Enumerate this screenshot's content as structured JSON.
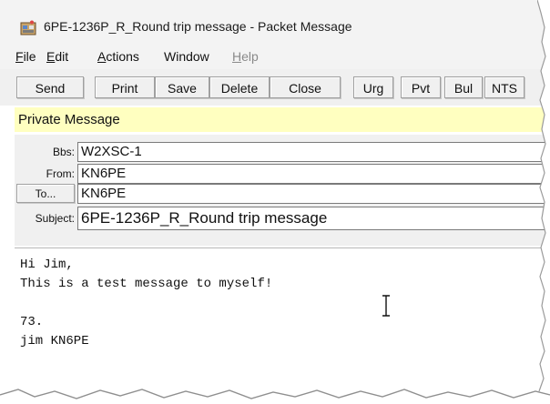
{
  "window": {
    "title": "6PE-1236P_R_Round trip message - Packet Message"
  },
  "menu": [
    {
      "label": "File",
      "underline": "F",
      "rest": "ile",
      "disabled": false
    },
    {
      "label": "Edit",
      "underline": "E",
      "rest": "dit",
      "disabled": false
    },
    {
      "label": "Actions",
      "underline": "A",
      "rest": "ctions",
      "disabled": false
    },
    {
      "label": "Window",
      "underline": "",
      "rest": "Window",
      "disabled": false
    },
    {
      "label": "Help",
      "underline": "H",
      "rest": "elp",
      "disabled": true
    }
  ],
  "toolbar": {
    "send": "Send",
    "print": "Print",
    "save": "Save",
    "delete": "Delete",
    "close": "Close",
    "urg": "Urg",
    "pvt": "Pvt",
    "bul": "Bul",
    "nts": "NTS"
  },
  "banner": "Private Message",
  "fields": {
    "bbs_label": "Bbs:",
    "bbs_value": "W2XSC-1",
    "from_label": "From:",
    "from_value": "KN6PE",
    "to_button": "To...",
    "to_value": "KN6PE",
    "subject_label": "Subject:",
    "subject_value": "6PE-1236P_R_Round trip message"
  },
  "body": {
    "lines": [
      "Hi Jim,",
      "This is a test message to myself!",
      "",
      "73.",
      "jim KN6PE"
    ]
  },
  "icons": {
    "app": "packet-message-app-icon",
    "cursor": "text-cursor-icon"
  }
}
